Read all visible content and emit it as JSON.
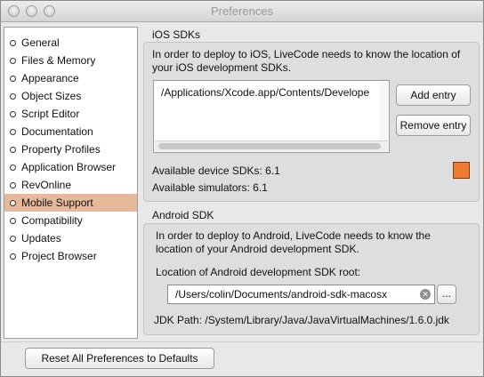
{
  "window": {
    "title": "Preferences"
  },
  "sidebar": {
    "items": [
      {
        "label": "General"
      },
      {
        "label": "Files & Memory"
      },
      {
        "label": "Appearance"
      },
      {
        "label": "Object Sizes"
      },
      {
        "label": "Script Editor"
      },
      {
        "label": "Documentation"
      },
      {
        "label": "Property Profiles"
      },
      {
        "label": "Application Browser"
      },
      {
        "label": "RevOnline"
      },
      {
        "label": "Mobile Support",
        "selected": true
      },
      {
        "label": "Compatibility"
      },
      {
        "label": "Updates"
      },
      {
        "label": "Project Browser"
      }
    ],
    "selected_color": "#e7b99b"
  },
  "ios": {
    "section_title": "iOS SDKs",
    "description_line1": "In order to deploy to iOS, LiveCode needs to know the location of",
    "description_line2": "your iOS development SDKs.",
    "sdk_list": [
      "/Applications/Xcode.app/Contents/Develope"
    ],
    "add_label": "Add entry",
    "remove_label": "Remove entry",
    "available_device": "Available device SDKs: 6.1",
    "available_simulators": "Available simulators: 6.1",
    "status_color": "#ef7b32"
  },
  "android": {
    "section_title": "Android SDK",
    "description_line1": "In order to deploy to Android, LiveCode needs to know the",
    "description_line2": "location of your Android development SDK.",
    "root_label": "Location of Android development SDK root:",
    "root_path": "/Users/colin/Documents/android-sdk-macosx",
    "browse_label": "...",
    "jdk_path": "JDK Path: /System/Library/Java/JavaVirtualMachines/1.6.0.jdk"
  },
  "footer": {
    "reset_label": "Reset All Preferences to Defaults"
  }
}
